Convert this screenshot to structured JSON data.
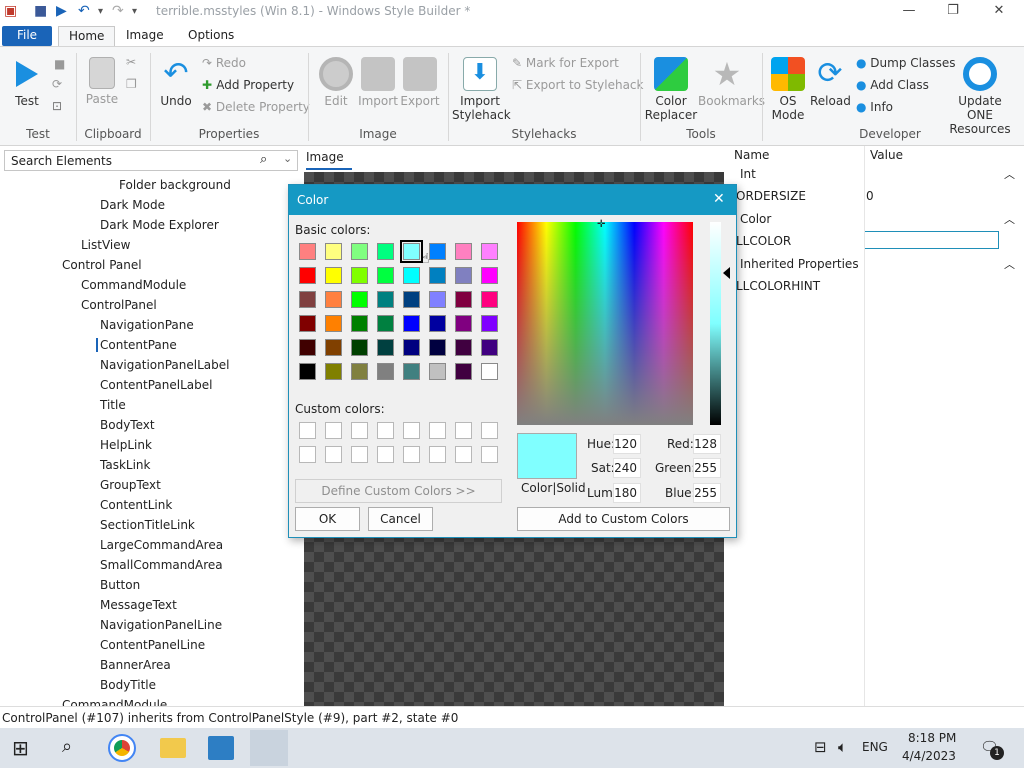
{
  "window": {
    "title": "terrible.msstyles (Win 8.1) - Windows Style Builder *",
    "minimize": "—",
    "maximize": "❐",
    "close": "✕"
  },
  "tabs": [
    "File",
    "Home",
    "Image",
    "Options"
  ],
  "ribbon": {
    "test": {
      "label": "Test",
      "group": "Test"
    },
    "clipboard": {
      "paste": "Paste",
      "group": "Clipboard"
    },
    "properties": {
      "undo": "Undo",
      "redo": "Redo",
      "add": "Add Property",
      "delete": "Delete Property",
      "group": "Properties"
    },
    "image": {
      "edit": "Edit",
      "import": "Import",
      "export": "Export",
      "group": "Image"
    },
    "stylehacks": {
      "import1": "Import",
      "import2": "Stylehack",
      "mark": "Mark for Export",
      "export": "Export to Stylehack",
      "group": "Stylehacks"
    },
    "tools": {
      "color1": "Color",
      "color2": "Replacer",
      "bookmarks": "Bookmarks",
      "group": "Tools"
    },
    "developer": {
      "os1": "OS",
      "os2": "Mode",
      "reload": "Reload",
      "dump": "Dump Classes",
      "addclass": "Add Class",
      "info": "Info",
      "update1": "Update ONE",
      "update2": "Resources",
      "group": "Developer"
    }
  },
  "search": {
    "placeholder": "Search Elements"
  },
  "tree": [
    {
      "label": "Folder background",
      "indent": 3
    },
    {
      "label": "Dark Mode",
      "indent": 2
    },
    {
      "label": "Dark Mode Explorer",
      "indent": 2
    },
    {
      "label": "ListView",
      "indent": 1
    },
    {
      "label": "Control Panel",
      "indent": 0
    },
    {
      "label": "CommandModule",
      "indent": 1
    },
    {
      "label": "ControlPanel",
      "indent": 1
    },
    {
      "label": "NavigationPane",
      "indent": 2
    },
    {
      "label": "ContentPane",
      "indent": 2
    },
    {
      "label": "NavigationPanelLabel",
      "indent": 2
    },
    {
      "label": "ContentPanelLabel",
      "indent": 2
    },
    {
      "label": "Title",
      "indent": 2
    },
    {
      "label": "BodyText",
      "indent": 2
    },
    {
      "label": "HelpLink",
      "indent": 2
    },
    {
      "label": "TaskLink",
      "indent": 2
    },
    {
      "label": "GroupText",
      "indent": 2
    },
    {
      "label": "ContentLink",
      "indent": 2
    },
    {
      "label": "SectionTitleLink",
      "indent": 2
    },
    {
      "label": "LargeCommandArea",
      "indent": 2
    },
    {
      "label": "SmallCommandArea",
      "indent": 2
    },
    {
      "label": "Button",
      "indent": 2
    },
    {
      "label": "MessageText",
      "indent": 2
    },
    {
      "label": "NavigationPanelLine",
      "indent": 2
    },
    {
      "label": "ContentPanelLine",
      "indent": 2
    },
    {
      "label": "BannerArea",
      "indent": 2
    },
    {
      "label": "BodyTitle",
      "indent": 2
    },
    {
      "label": "CommandModule",
      "indent": 0
    }
  ],
  "image_tab": "Image",
  "props": {
    "col_name": "Name",
    "col_value": "Value",
    "sections": [
      {
        "header": "Int",
        "rows": [
          {
            "name": "ORDERSIZE",
            "value": "0"
          }
        ]
      },
      {
        "header": "Color",
        "rows": [
          {
            "name": "LLCOLOR",
            "value": ""
          }
        ]
      },
      {
        "header": "Inherited Properties",
        "rows": [
          {
            "name": "LLCOLORHINT",
            "value": ""
          }
        ]
      }
    ]
  },
  "status": "ControlPanel (#107) inherits from ControlPanelStyle (#9), part #2, state #0",
  "taskbar": {
    "time": "8:18 PM",
    "date": "4/4/2023",
    "lang": "ENG",
    "badge": "1"
  },
  "dialog": {
    "title": "Color",
    "basic_label": "Basic colors:",
    "custom_label": "Custom colors:",
    "define": "Define Custom Colors >>",
    "ok": "OK",
    "cancel": "Cancel",
    "add_custom": "Add to Custom Colors",
    "solid": "Color|Solid",
    "fields": {
      "hue_label": "Hue:",
      "hue": "120",
      "sat_label": "Sat:",
      "sat": "240",
      "lum_label": "Lum:",
      "lum": "180",
      "red_label": "Red:",
      "red": "128",
      "green_label": "Green:",
      "green": "255",
      "blue_label": "Blue:",
      "blue": "255"
    },
    "selected_color": "#80ffff",
    "basic_colors": [
      "#ff8080",
      "#ffff80",
      "#80ff80",
      "#00ff80",
      "#80ffff",
      "#0080ff",
      "#ff80c0",
      "#ff80ff",
      "#ff0000",
      "#ffff00",
      "#80ff00",
      "#00ff40",
      "#00ffff",
      "#0080c0",
      "#8080c0",
      "#ff00ff",
      "#804040",
      "#ff8040",
      "#00ff00",
      "#008080",
      "#004080",
      "#8080ff",
      "#800040",
      "#ff0080",
      "#800000",
      "#ff8000",
      "#008000",
      "#008040",
      "#0000ff",
      "#0000a0",
      "#800080",
      "#8000ff",
      "#400000",
      "#804000",
      "#004000",
      "#004040",
      "#000080",
      "#000040",
      "#400040",
      "#400080",
      "#000000",
      "#808000",
      "#808040",
      "#808080",
      "#408080",
      "#c0c0c0",
      "#400040",
      "#ffffff"
    ],
    "selected_index": 4
  }
}
